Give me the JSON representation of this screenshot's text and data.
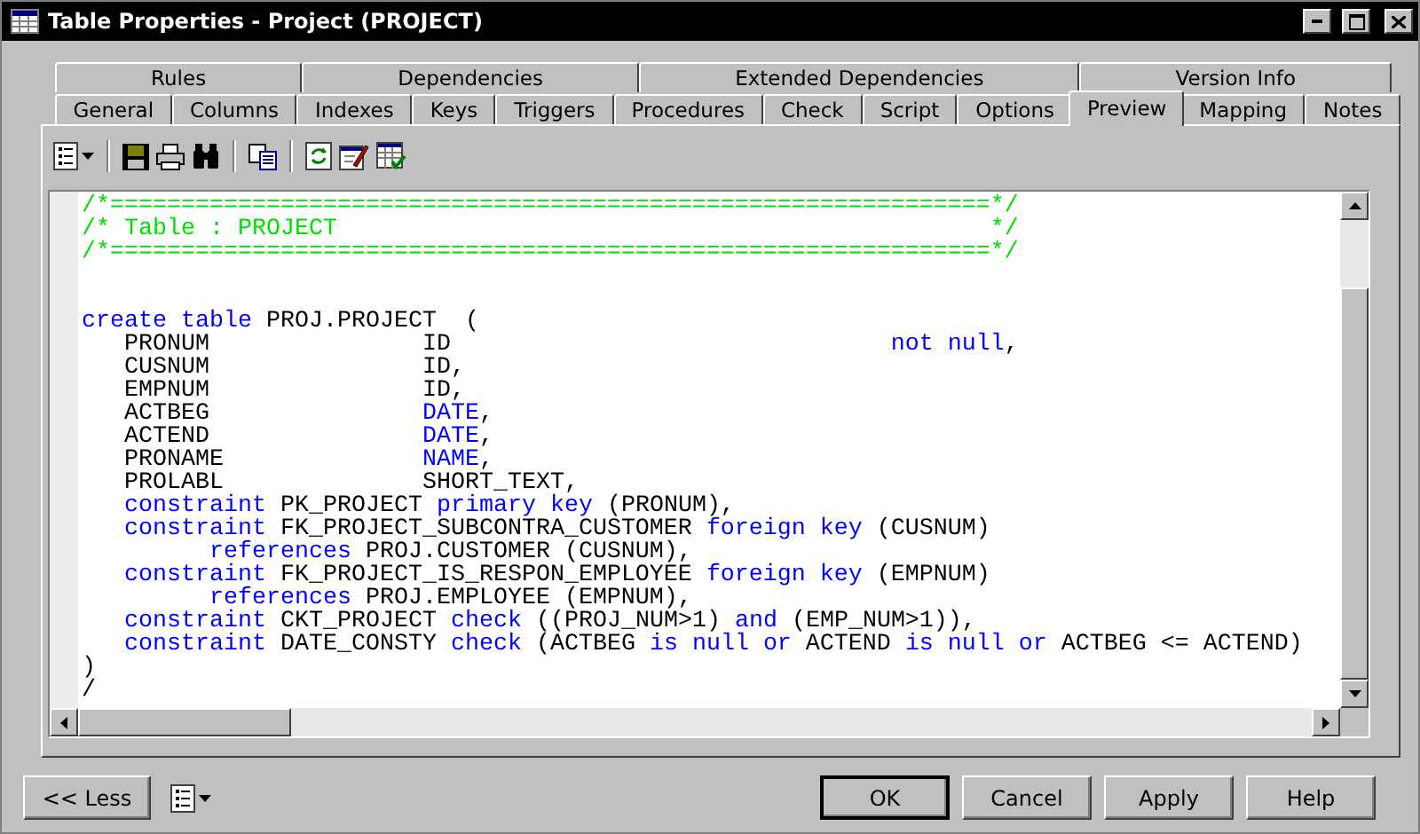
{
  "window": {
    "title": "Table Properties - Project (PROJECT)"
  },
  "tab_rows": [
    {
      "tabs": [
        {
          "label": "Rules",
          "selected": false
        },
        {
          "label": "Dependencies",
          "selected": false
        },
        {
          "label": "Extended Dependencies",
          "selected": false
        },
        {
          "label": "Version Info",
          "selected": false
        }
      ]
    },
    {
      "tabs": [
        {
          "label": "General",
          "selected": false
        },
        {
          "label": "Columns",
          "selected": false
        },
        {
          "label": "Indexes",
          "selected": false
        },
        {
          "label": "Keys",
          "selected": false
        },
        {
          "label": "Triggers",
          "selected": false
        },
        {
          "label": "Procedures",
          "selected": false
        },
        {
          "label": "Check",
          "selected": false
        },
        {
          "label": "Script",
          "selected": false
        },
        {
          "label": "Options",
          "selected": false
        },
        {
          "label": "Preview",
          "selected": true
        },
        {
          "label": "Mapping",
          "selected": false
        },
        {
          "label": "Notes",
          "selected": false
        }
      ]
    }
  ],
  "preview_lines": [
    {
      "kind": "code",
      "segments": [
        {
          "kind": "comment",
          "text": "/*==============================================================*/"
        }
      ]
    },
    {
      "kind": "code",
      "segments": [
        {
          "kind": "comment",
          "text": "/* Table : PROJECT                                              */"
        }
      ]
    },
    {
      "kind": "code",
      "segments": [
        {
          "kind": "comment",
          "text": "/*==============================================================*/"
        }
      ]
    },
    {
      "kind": "blank"
    },
    {
      "kind": "blank"
    },
    {
      "kind": "code",
      "segments": [
        {
          "kind": "keyword",
          "text": "create table"
        },
        {
          "kind": "plain",
          "text": " PROJ.PROJECT  ("
        }
      ]
    },
    {
      "kind": "code",
      "segments": [
        {
          "kind": "plain",
          "text": "   PRONUM               ID                               "
        },
        {
          "kind": "keyword",
          "text": "not null"
        },
        {
          "kind": "plain",
          "text": ","
        }
      ]
    },
    {
      "kind": "code",
      "segments": [
        {
          "kind": "plain",
          "text": "   CUSNUM               ID,"
        }
      ]
    },
    {
      "kind": "code",
      "segments": [
        {
          "kind": "plain",
          "text": "   EMPNUM               ID,"
        }
      ]
    },
    {
      "kind": "code",
      "segments": [
        {
          "kind": "plain",
          "text": "   ACTBEG               "
        },
        {
          "kind": "keyword",
          "text": "DATE"
        },
        {
          "kind": "plain",
          "text": ","
        }
      ]
    },
    {
      "kind": "code",
      "segments": [
        {
          "kind": "plain",
          "text": "   ACTEND               "
        },
        {
          "kind": "keyword",
          "text": "DATE"
        },
        {
          "kind": "plain",
          "text": ","
        }
      ]
    },
    {
      "kind": "code",
      "segments": [
        {
          "kind": "plain",
          "text": "   PRONAME              "
        },
        {
          "kind": "keyword",
          "text": "NAME"
        },
        {
          "kind": "plain",
          "text": ","
        }
      ]
    },
    {
      "kind": "code",
      "segments": [
        {
          "kind": "plain",
          "text": "   PROLABL              SHORT_TEXT,"
        }
      ]
    },
    {
      "kind": "code",
      "segments": [
        {
          "kind": "keyword",
          "text": "   constraint"
        },
        {
          "kind": "plain",
          "text": " PK_PROJECT "
        },
        {
          "kind": "keyword",
          "text": "primary key"
        },
        {
          "kind": "plain",
          "text": " (PRONUM),"
        }
      ]
    },
    {
      "kind": "code",
      "segments": [
        {
          "kind": "keyword",
          "text": "   constraint"
        },
        {
          "kind": "plain",
          "text": " FK_PROJECT_SUBCONTRA_CUSTOMER "
        },
        {
          "kind": "keyword",
          "text": "foreign key"
        },
        {
          "kind": "plain",
          "text": " (CUSNUM)"
        }
      ]
    },
    {
      "kind": "code",
      "segments": [
        {
          "kind": "keyword",
          "text": "         references"
        },
        {
          "kind": "plain",
          "text": " PROJ.CUSTOMER (CUSNUM),"
        }
      ]
    },
    {
      "kind": "code",
      "segments": [
        {
          "kind": "keyword",
          "text": "   constraint"
        },
        {
          "kind": "plain",
          "text": " FK_PROJECT_IS_RESPON_EMPLOYEE "
        },
        {
          "kind": "keyword",
          "text": "foreign key"
        },
        {
          "kind": "plain",
          "text": " (EMPNUM)"
        }
      ]
    },
    {
      "kind": "code",
      "segments": [
        {
          "kind": "keyword",
          "text": "         references"
        },
        {
          "kind": "plain",
          "text": " PROJ.EMPLOYEE (EMPNUM),"
        }
      ]
    },
    {
      "kind": "code",
      "segments": [
        {
          "kind": "keyword",
          "text": "   constraint"
        },
        {
          "kind": "plain",
          "text": " CKT_PROJECT "
        },
        {
          "kind": "keyword",
          "text": "check"
        },
        {
          "kind": "plain",
          "text": " ((PROJ_NUM>1) "
        },
        {
          "kind": "keyword",
          "text": "and"
        },
        {
          "kind": "plain",
          "text": " (EMP_NUM>1)),"
        }
      ]
    },
    {
      "kind": "code",
      "segments": [
        {
          "kind": "keyword",
          "text": "   constraint"
        },
        {
          "kind": "plain",
          "text": " DATE_CONSTY "
        },
        {
          "kind": "keyword",
          "text": "check"
        },
        {
          "kind": "plain",
          "text": " (ACTBEG "
        },
        {
          "kind": "keyword",
          "text": "is null or"
        },
        {
          "kind": "plain",
          "text": " ACTEND "
        },
        {
          "kind": "keyword",
          "text": "is null or"
        },
        {
          "kind": "plain",
          "text": " ACTBEG <= ACTEND)"
        }
      ]
    },
    {
      "kind": "code",
      "segments": [
        {
          "kind": "plain",
          "text": ")"
        }
      ]
    },
    {
      "kind": "code",
      "segments": [
        {
          "kind": "plain",
          "text": "/"
        }
      ]
    }
  ],
  "footer": {
    "less_button": "<< Less",
    "buttons": [
      {
        "label": "OK",
        "default": true
      },
      {
        "label": "Cancel",
        "default": false
      },
      {
        "label": "Apply",
        "default": false
      },
      {
        "label": "Help",
        "default": false
      }
    ]
  }
}
